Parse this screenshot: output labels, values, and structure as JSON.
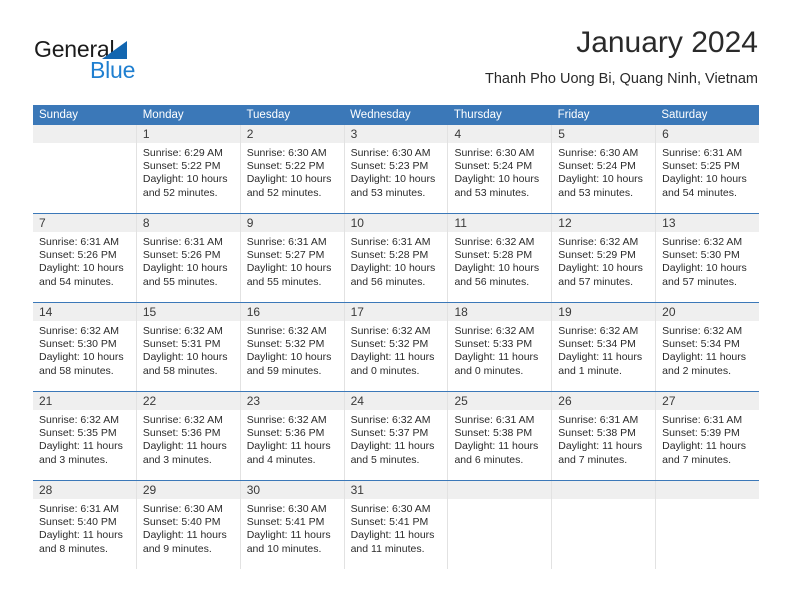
{
  "brand": {
    "name_part1": "General",
    "name_part2": "Blue",
    "triangle_color": "#1266b0",
    "blue_color": "#1f7fd0"
  },
  "header": {
    "title": "January 2024",
    "subtitle": "Thanh Pho Uong Bi, Quang Ninh, Vietnam"
  },
  "theme": {
    "header_bar": "#3b78b8",
    "daynum_bg": "#efefef",
    "cell_divider": "#e2e2e2",
    "text": "#2b2b2b"
  },
  "weekdays": [
    "Sunday",
    "Monday",
    "Tuesday",
    "Wednesday",
    "Thursday",
    "Friday",
    "Saturday"
  ],
  "weeks": [
    [
      {
        "day": "",
        "sunrise": "",
        "sunset": "",
        "daylight_line1": "",
        "daylight_line2": "",
        "empty": true
      },
      {
        "day": "1",
        "sunrise": "Sunrise: 6:29 AM",
        "sunset": "Sunset: 5:22 PM",
        "daylight_line1": "Daylight: 10 hours",
        "daylight_line2": "and 52 minutes.",
        "empty": false
      },
      {
        "day": "2",
        "sunrise": "Sunrise: 6:30 AM",
        "sunset": "Sunset: 5:22 PM",
        "daylight_line1": "Daylight: 10 hours",
        "daylight_line2": "and 52 minutes.",
        "empty": false
      },
      {
        "day": "3",
        "sunrise": "Sunrise: 6:30 AM",
        "sunset": "Sunset: 5:23 PM",
        "daylight_line1": "Daylight: 10 hours",
        "daylight_line2": "and 53 minutes.",
        "empty": false
      },
      {
        "day": "4",
        "sunrise": "Sunrise: 6:30 AM",
        "sunset": "Sunset: 5:24 PM",
        "daylight_line1": "Daylight: 10 hours",
        "daylight_line2": "and 53 minutes.",
        "empty": false
      },
      {
        "day": "5",
        "sunrise": "Sunrise: 6:30 AM",
        "sunset": "Sunset: 5:24 PM",
        "daylight_line1": "Daylight: 10 hours",
        "daylight_line2": "and 53 minutes.",
        "empty": false
      },
      {
        "day": "6",
        "sunrise": "Sunrise: 6:31 AM",
        "sunset": "Sunset: 5:25 PM",
        "daylight_line1": "Daylight: 10 hours",
        "daylight_line2": "and 54 minutes.",
        "empty": false
      }
    ],
    [
      {
        "day": "7",
        "sunrise": "Sunrise: 6:31 AM",
        "sunset": "Sunset: 5:26 PM",
        "daylight_line1": "Daylight: 10 hours",
        "daylight_line2": "and 54 minutes.",
        "empty": false
      },
      {
        "day": "8",
        "sunrise": "Sunrise: 6:31 AM",
        "sunset": "Sunset: 5:26 PM",
        "daylight_line1": "Daylight: 10 hours",
        "daylight_line2": "and 55 minutes.",
        "empty": false
      },
      {
        "day": "9",
        "sunrise": "Sunrise: 6:31 AM",
        "sunset": "Sunset: 5:27 PM",
        "daylight_line1": "Daylight: 10 hours",
        "daylight_line2": "and 55 minutes.",
        "empty": false
      },
      {
        "day": "10",
        "sunrise": "Sunrise: 6:31 AM",
        "sunset": "Sunset: 5:28 PM",
        "daylight_line1": "Daylight: 10 hours",
        "daylight_line2": "and 56 minutes.",
        "empty": false
      },
      {
        "day": "11",
        "sunrise": "Sunrise: 6:32 AM",
        "sunset": "Sunset: 5:28 PM",
        "daylight_line1": "Daylight: 10 hours",
        "daylight_line2": "and 56 minutes.",
        "empty": false
      },
      {
        "day": "12",
        "sunrise": "Sunrise: 6:32 AM",
        "sunset": "Sunset: 5:29 PM",
        "daylight_line1": "Daylight: 10 hours",
        "daylight_line2": "and 57 minutes.",
        "empty": false
      },
      {
        "day": "13",
        "sunrise": "Sunrise: 6:32 AM",
        "sunset": "Sunset: 5:30 PM",
        "daylight_line1": "Daylight: 10 hours",
        "daylight_line2": "and 57 minutes.",
        "empty": false
      }
    ],
    [
      {
        "day": "14",
        "sunrise": "Sunrise: 6:32 AM",
        "sunset": "Sunset: 5:30 PM",
        "daylight_line1": "Daylight: 10 hours",
        "daylight_line2": "and 58 minutes.",
        "empty": false
      },
      {
        "day": "15",
        "sunrise": "Sunrise: 6:32 AM",
        "sunset": "Sunset: 5:31 PM",
        "daylight_line1": "Daylight: 10 hours",
        "daylight_line2": "and 58 minutes.",
        "empty": false
      },
      {
        "day": "16",
        "sunrise": "Sunrise: 6:32 AM",
        "sunset": "Sunset: 5:32 PM",
        "daylight_line1": "Daylight: 10 hours",
        "daylight_line2": "and 59 minutes.",
        "empty": false
      },
      {
        "day": "17",
        "sunrise": "Sunrise: 6:32 AM",
        "sunset": "Sunset: 5:32 PM",
        "daylight_line1": "Daylight: 11 hours",
        "daylight_line2": "and 0 minutes.",
        "empty": false
      },
      {
        "day": "18",
        "sunrise": "Sunrise: 6:32 AM",
        "sunset": "Sunset: 5:33 PM",
        "daylight_line1": "Daylight: 11 hours",
        "daylight_line2": "and 0 minutes.",
        "empty": false
      },
      {
        "day": "19",
        "sunrise": "Sunrise: 6:32 AM",
        "sunset": "Sunset: 5:34 PM",
        "daylight_line1": "Daylight: 11 hours",
        "daylight_line2": "and 1 minute.",
        "empty": false
      },
      {
        "day": "20",
        "sunrise": "Sunrise: 6:32 AM",
        "sunset": "Sunset: 5:34 PM",
        "daylight_line1": "Daylight: 11 hours",
        "daylight_line2": "and 2 minutes.",
        "empty": false
      }
    ],
    [
      {
        "day": "21",
        "sunrise": "Sunrise: 6:32 AM",
        "sunset": "Sunset: 5:35 PM",
        "daylight_line1": "Daylight: 11 hours",
        "daylight_line2": "and 3 minutes.",
        "empty": false
      },
      {
        "day": "22",
        "sunrise": "Sunrise: 6:32 AM",
        "sunset": "Sunset: 5:36 PM",
        "daylight_line1": "Daylight: 11 hours",
        "daylight_line2": "and 3 minutes.",
        "empty": false
      },
      {
        "day": "23",
        "sunrise": "Sunrise: 6:32 AM",
        "sunset": "Sunset: 5:36 PM",
        "daylight_line1": "Daylight: 11 hours",
        "daylight_line2": "and 4 minutes.",
        "empty": false
      },
      {
        "day": "24",
        "sunrise": "Sunrise: 6:32 AM",
        "sunset": "Sunset: 5:37 PM",
        "daylight_line1": "Daylight: 11 hours",
        "daylight_line2": "and 5 minutes.",
        "empty": false
      },
      {
        "day": "25",
        "sunrise": "Sunrise: 6:31 AM",
        "sunset": "Sunset: 5:38 PM",
        "daylight_line1": "Daylight: 11 hours",
        "daylight_line2": "and 6 minutes.",
        "empty": false
      },
      {
        "day": "26",
        "sunrise": "Sunrise: 6:31 AM",
        "sunset": "Sunset: 5:38 PM",
        "daylight_line1": "Daylight: 11 hours",
        "daylight_line2": "and 7 minutes.",
        "empty": false
      },
      {
        "day": "27",
        "sunrise": "Sunrise: 6:31 AM",
        "sunset": "Sunset: 5:39 PM",
        "daylight_line1": "Daylight: 11 hours",
        "daylight_line2": "and 7 minutes.",
        "empty": false
      }
    ],
    [
      {
        "day": "28",
        "sunrise": "Sunrise: 6:31 AM",
        "sunset": "Sunset: 5:40 PM",
        "daylight_line1": "Daylight: 11 hours",
        "daylight_line2": "and 8 minutes.",
        "empty": false
      },
      {
        "day": "29",
        "sunrise": "Sunrise: 6:30 AM",
        "sunset": "Sunset: 5:40 PM",
        "daylight_line1": "Daylight: 11 hours",
        "daylight_line2": "and 9 minutes.",
        "empty": false
      },
      {
        "day": "30",
        "sunrise": "Sunrise: 6:30 AM",
        "sunset": "Sunset: 5:41 PM",
        "daylight_line1": "Daylight: 11 hours",
        "daylight_line2": "and 10 minutes.",
        "empty": false
      },
      {
        "day": "31",
        "sunrise": "Sunrise: 6:30 AM",
        "sunset": "Sunset: 5:41 PM",
        "daylight_line1": "Daylight: 11 hours",
        "daylight_line2": "and 11 minutes.",
        "empty": false
      },
      {
        "day": "",
        "sunrise": "",
        "sunset": "",
        "daylight_line1": "",
        "daylight_line2": "",
        "empty": true
      },
      {
        "day": "",
        "sunrise": "",
        "sunset": "",
        "daylight_line1": "",
        "daylight_line2": "",
        "empty": true
      },
      {
        "day": "",
        "sunrise": "",
        "sunset": "",
        "daylight_line1": "",
        "daylight_line2": "",
        "empty": true
      }
    ]
  ]
}
